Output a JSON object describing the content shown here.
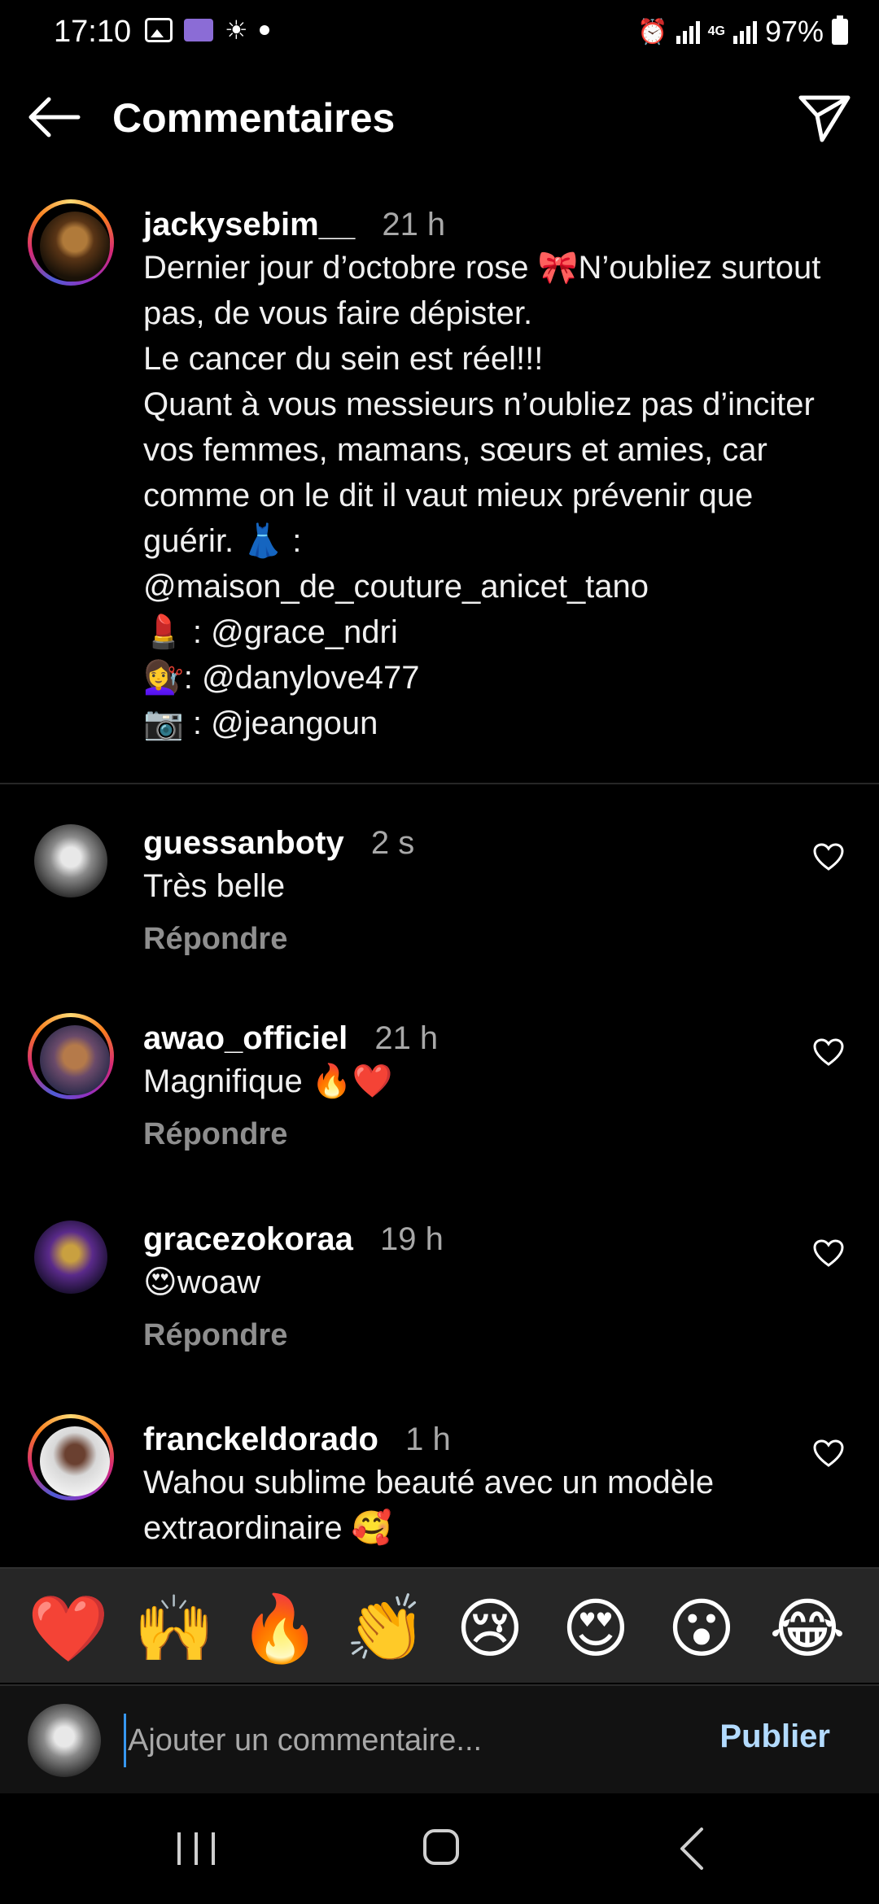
{
  "status_bar": {
    "time": "17:10",
    "battery": "97%",
    "network": "4G"
  },
  "header": {
    "title": "Commentaires"
  },
  "caption": {
    "username": "jackysebim__",
    "time": "21 h",
    "text": "Dernier jour d’octobre rose 🎀N’oubliez surtout pas, de vous faire dépister.\nLe cancer du sein est réel!!!\nQuant à vous messieurs n’oubliez pas d’inciter vos femmes, mamans, sœurs et amies, car comme on le dit il vaut mieux prévenir que guérir. 👗 :\n@maison_de_couture_anicet_tano\n💄 : @grace_ndri\n💇‍♀️: @danylove477\n📷 : @jeangoun"
  },
  "comments": [
    {
      "username": "guessanboty",
      "time": "2 s",
      "text": "Très belle",
      "reply": "Répondre"
    },
    {
      "username": "awao_officiel",
      "time": "21 h",
      "text": "Magnifique 🔥❤️",
      "reply": "Répondre"
    },
    {
      "username": "gracezokoraa",
      "time": "19 h",
      "text": "😍woaw",
      "reply": "Répondre"
    },
    {
      "username": "franckeldorado",
      "time": "1 h",
      "text": "Wahou sublime beauté avec un modèle extraordinaire 🥰"
    }
  ],
  "emoji_bar": [
    "❤️",
    "🙌",
    "🔥",
    "👏",
    "😢",
    "😍",
    "😮",
    "😂"
  ],
  "composer": {
    "placeholder": "Ajouter un commentaire...",
    "publish_label": "Publier"
  },
  "colors": {
    "background": "#000000",
    "muted": "#a8a8a8",
    "accent": "#3797f0",
    "publish": "#b3dbff"
  },
  "icons": [
    "back-arrow-icon",
    "send-icon",
    "heart-outline-icon",
    "recent-apps-icon",
    "home-icon",
    "nav-back-icon"
  ]
}
